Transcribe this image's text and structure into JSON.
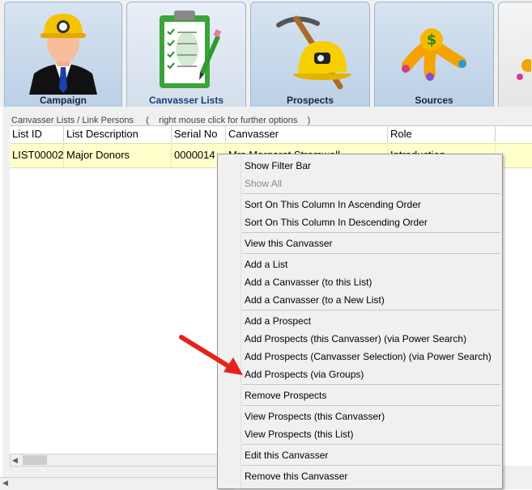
{
  "tabs": [
    {
      "label": "Campaign",
      "icon": "miner-person-icon",
      "active": false
    },
    {
      "label": "Canvasser Lists",
      "icon": "clipboard-checklist-icon",
      "active": true
    },
    {
      "label": "Prospects",
      "icon": "pickaxe-hardhat-icon",
      "active": false
    },
    {
      "label": "Sources",
      "icon": "money-hand-icon",
      "active": false
    }
  ],
  "panel": {
    "caption": "Canvasser Lists / Link Persons     (    right mouse click for further options    )"
  },
  "grid": {
    "columns": [
      "List ID",
      "List Description",
      "Serial No",
      "Canvasser",
      "Role"
    ],
    "rows": [
      [
        "LIST00002",
        "Major Donors",
        "0000014",
        "Mrs Margaret Stromwell",
        "Introduction"
      ]
    ]
  },
  "menu": {
    "items": [
      {
        "label": "Show Filter Bar",
        "enabled": true
      },
      {
        "label": "Show All",
        "enabled": false
      },
      {
        "label": "Sort On This Column In Ascending Order",
        "enabled": true
      },
      {
        "label": "Sort On This Column In Descending Order",
        "enabled": true
      },
      {
        "label": "View this Canvasser",
        "enabled": true
      },
      {
        "label": "Add a List",
        "enabled": true
      },
      {
        "label": "Add a Canvasser (to this List)",
        "enabled": true
      },
      {
        "label": "Add a Canvasser (to a New List)",
        "enabled": true
      },
      {
        "label": "Add a Prospect",
        "enabled": true
      },
      {
        "label": "Add Prospects (this Canvasser) (via Power Search)",
        "enabled": true
      },
      {
        "label": "Add Prospects (Canvasser Selection) (via Power Search)",
        "enabled": true
      },
      {
        "label": "Add Prospects (via Groups)",
        "enabled": true
      },
      {
        "label": "Remove Prospects",
        "enabled": true
      },
      {
        "label": "View Prospects (this Canvasser)",
        "enabled": true
      },
      {
        "label": "View Prospects (this List)",
        "enabled": true
      },
      {
        "label": "Edit this Canvasser",
        "enabled": true
      },
      {
        "label": "Remove this Canvasser",
        "enabled": true
      }
    ]
  },
  "annotation": {
    "color": "#e8211c",
    "points_to": "Add Prospects (via Groups)"
  },
  "colors": {
    "selected_row": "#ffffcc",
    "active_tab_text": "#1e3e73",
    "tab_bg": "#c9d9ea"
  }
}
